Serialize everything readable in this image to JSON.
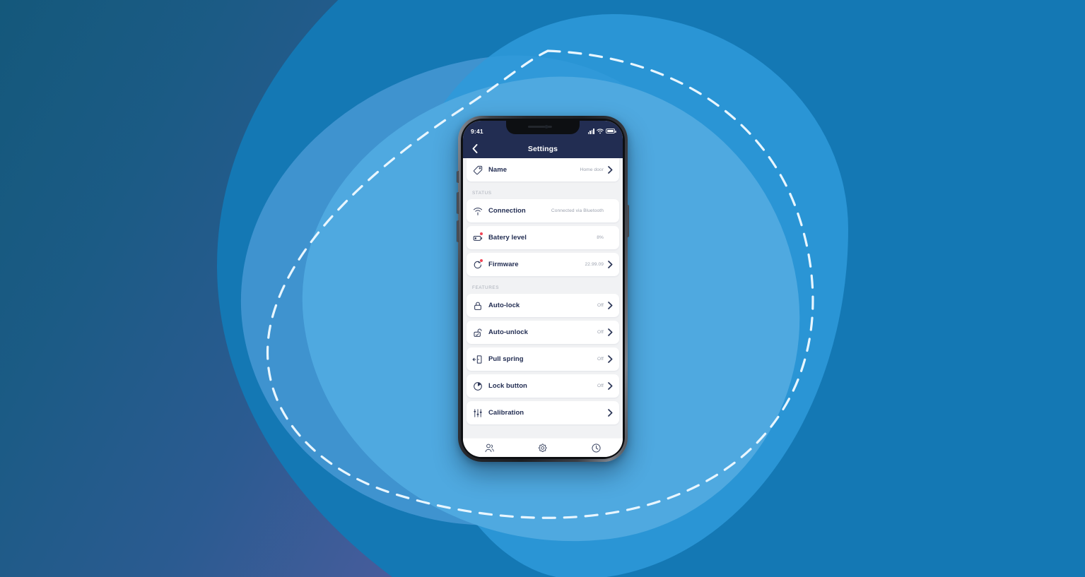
{
  "background": {
    "gradient_from": "#14587b",
    "gradient_mid": "#4a5c9d",
    "gradient_to": "#9a80bd",
    "blue_field": "#1478b4",
    "blob_mid": "#3f93cf",
    "blob_light": "#4fa9e0",
    "dashed_stroke": "#e8f6ff"
  },
  "phone": {
    "status_bar": {
      "time": "9:41",
      "signal_icon": "signal-bars-icon",
      "wifi_icon": "wifi-icon",
      "battery_icon": "battery-icon"
    },
    "navbar": {
      "back_icon": "chevron-left-icon",
      "title": "Settings",
      "bg": "#222d52"
    },
    "sections": [
      {
        "id": "name",
        "header": null,
        "rows": [
          {
            "icon": "tag-icon",
            "label": "Name",
            "value": "Home door",
            "chevron": true,
            "badge": false
          }
        ]
      },
      {
        "id": "status",
        "header": "STATUS",
        "rows": [
          {
            "icon": "wifi-signal-icon",
            "label": "Connection",
            "value": "Connected via Bluetooth",
            "chevron": false,
            "badge": false
          },
          {
            "icon": "battery-icon",
            "label": "Batery level",
            "value": "8%",
            "chevron": false,
            "badge": true
          },
          {
            "icon": "firmware-update-icon",
            "label": "Firmware",
            "value": "22.99.09",
            "chevron": true,
            "badge": true
          }
        ]
      },
      {
        "id": "features",
        "header": "FEATURES",
        "rows": [
          {
            "icon": "lock-closed-icon",
            "label": "Auto-lock",
            "value": "Off",
            "chevron": true,
            "badge": false
          },
          {
            "icon": "lock-open-icon",
            "label": "Auto-unlock",
            "value": "Off",
            "chevron": true,
            "badge": false
          },
          {
            "icon": "pull-spring-icon",
            "label": "Pull spring",
            "value": "Off",
            "chevron": true,
            "badge": false
          },
          {
            "icon": "lock-button-icon",
            "label": "Lock button",
            "value": "Off",
            "chevron": true,
            "badge": false
          },
          {
            "icon": "sliders-icon",
            "label": "Calibration",
            "value": "",
            "chevron": true,
            "badge": false
          }
        ]
      }
    ],
    "tabbar": {
      "tabs": [
        {
          "id": "users",
          "icon": "users-icon"
        },
        {
          "id": "settings",
          "icon": "gear-icon"
        },
        {
          "id": "history",
          "icon": "clock-icon"
        }
      ]
    }
  }
}
